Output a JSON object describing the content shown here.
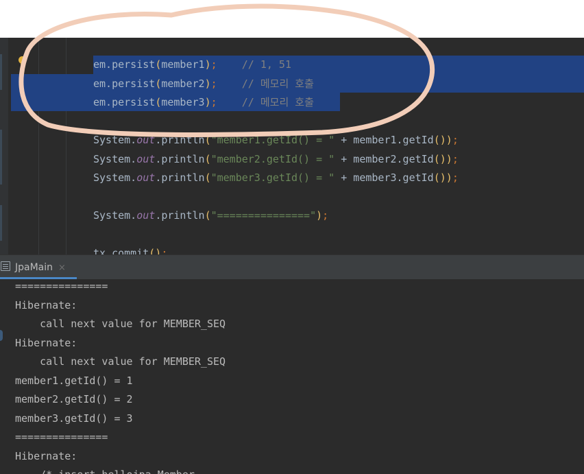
{
  "editor": {
    "code_lines": [
      {
        "tokens": [
          {
            "t": "em.persist",
            "c": "plain"
          },
          {
            "t": "(",
            "c": "paren"
          },
          {
            "t": "member1",
            "c": "plain"
          },
          {
            "t": ")",
            "c": "paren"
          },
          {
            "t": ";",
            "c": "punct"
          },
          {
            "t": "    // 1, 51",
            "c": "comment"
          }
        ]
      },
      {
        "tokens": [
          {
            "t": "em.persist",
            "c": "plain"
          },
          {
            "t": "(",
            "c": "paren"
          },
          {
            "t": "member2",
            "c": "plain"
          },
          {
            "t": ")",
            "c": "paren"
          },
          {
            "t": ";",
            "c": "punct"
          },
          {
            "t": "    // 메모리 호출",
            "c": "comment"
          }
        ]
      },
      {
        "tokens": [
          {
            "t": "em.persist",
            "c": "plain"
          },
          {
            "t": "(",
            "c": "paren"
          },
          {
            "t": "member3",
            "c": "plain"
          },
          {
            "t": ")",
            "c": "paren"
          },
          {
            "t": ";",
            "c": "punct"
          },
          {
            "t": "    // 메모리 호출",
            "c": "comment"
          }
        ]
      },
      {
        "tokens": []
      },
      {
        "tokens": [
          {
            "t": "System.",
            "c": "plain"
          },
          {
            "t": "out",
            "c": "static"
          },
          {
            "t": ".println",
            "c": "plain"
          },
          {
            "t": "(",
            "c": "paren"
          },
          {
            "t": "\"member1.getId() = \"",
            "c": "str"
          },
          {
            "t": " + member1.getId",
            "c": "plain"
          },
          {
            "t": "()",
            "c": "paren"
          },
          {
            "t": ")",
            "c": "paren"
          },
          {
            "t": ";",
            "c": "punct"
          }
        ]
      },
      {
        "tokens": [
          {
            "t": "System.",
            "c": "plain"
          },
          {
            "t": "out",
            "c": "static"
          },
          {
            "t": ".println",
            "c": "plain"
          },
          {
            "t": "(",
            "c": "paren"
          },
          {
            "t": "\"member2.getId() = \"",
            "c": "str"
          },
          {
            "t": " + member2.getId",
            "c": "plain"
          },
          {
            "t": "()",
            "c": "paren"
          },
          {
            "t": ")",
            "c": "paren"
          },
          {
            "t": ";",
            "c": "punct"
          }
        ]
      },
      {
        "tokens": [
          {
            "t": "System.",
            "c": "plain"
          },
          {
            "t": "out",
            "c": "static"
          },
          {
            "t": ".println",
            "c": "plain"
          },
          {
            "t": "(",
            "c": "paren"
          },
          {
            "t": "\"member3.getId() = \"",
            "c": "str"
          },
          {
            "t": " + member3.getId",
            "c": "plain"
          },
          {
            "t": "()",
            "c": "paren"
          },
          {
            "t": ")",
            "c": "paren"
          },
          {
            "t": ";",
            "c": "punct"
          }
        ]
      },
      {
        "tokens": []
      },
      {
        "tokens": [
          {
            "t": "System.",
            "c": "plain"
          },
          {
            "t": "out",
            "c": "static"
          },
          {
            "t": ".println",
            "c": "plain"
          },
          {
            "t": "(",
            "c": "paren"
          },
          {
            "t": "\"===============\"",
            "c": "str"
          },
          {
            "t": ")",
            "c": "paren"
          },
          {
            "t": ";",
            "c": "punct"
          }
        ]
      },
      {
        "tokens": []
      },
      {
        "tokens": [
          {
            "t": "tx.commit",
            "c": "plain"
          },
          {
            "t": "()",
            "c": "paren"
          },
          {
            "t": ";",
            "c": "punct"
          }
        ]
      }
    ]
  },
  "tool_window": {
    "tab_label": "JpaMain",
    "close_glyph": "×"
  },
  "console": {
    "lines": [
      "===============",
      "Hibernate: ",
      "    call next value for MEMBER_SEQ",
      "Hibernate: ",
      "    call next value for MEMBER_SEQ",
      "member1.getId() = 1",
      "member2.getId() = 2",
      "member3.getId() = 3",
      "===============",
      "Hibernate: ",
      "    /* insert hellojpa.Member"
    ]
  },
  "colors": {
    "editor_bg": "#2b2b2b",
    "selection": "#214283",
    "annotation_stroke": "#f2cdb8"
  },
  "icons": {
    "intention_bulb": "lightbulb-icon",
    "tool_tab_icon": "console-window-icon"
  }
}
